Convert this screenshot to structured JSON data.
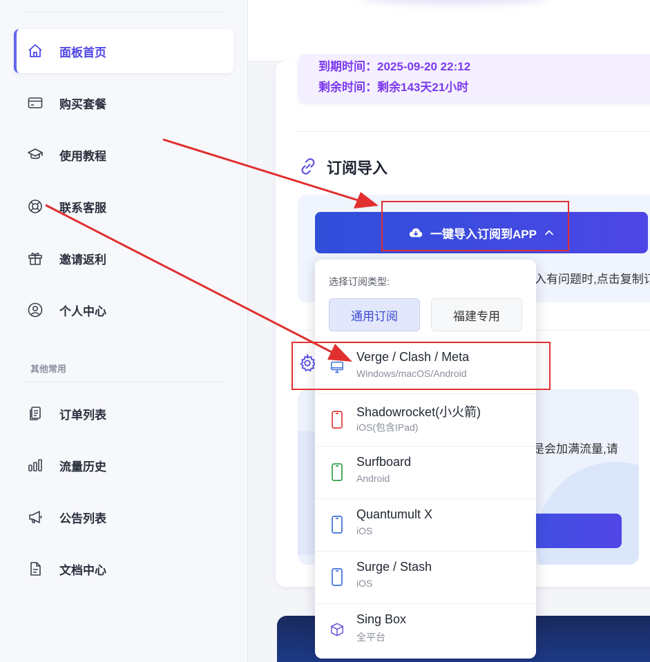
{
  "sidebar": {
    "items": [
      {
        "label": "面板首页",
        "icon": "home-icon",
        "active": true
      },
      {
        "label": "购买套餐",
        "icon": "card-icon"
      },
      {
        "label": "使用教程",
        "icon": "graduation-cap-icon"
      },
      {
        "label": "联系客服",
        "icon": "lifebuoy-icon"
      },
      {
        "label": "邀请返利",
        "icon": "gift-icon"
      },
      {
        "label": "个人中心",
        "icon": "user-circle-icon"
      }
    ],
    "section_label": "其他常用",
    "other_items": [
      {
        "label": "订单列表",
        "icon": "clipboard-icon"
      },
      {
        "label": "流量历史",
        "icon": "bar-chart-icon"
      },
      {
        "label": "公告列表",
        "icon": "megaphone-icon"
      },
      {
        "label": "文档中心",
        "icon": "document-icon"
      }
    ]
  },
  "main": {
    "expire_line": "到期时间：2025-09-20 22:12",
    "remaining_line": "剩余时间：剩余143天21小时",
    "subscription_title": "订阅导入",
    "import_button": "一键导入订阅到APP",
    "hint_text_partial": "入有问题时,点击复制订",
    "promo_text_partial": "是会加满流量,请"
  },
  "dropdown": {
    "caption": "选择订阅类型:",
    "type_general": "通用订阅",
    "type_fujian": "福建专用",
    "apps": [
      {
        "name": "Verge / Clash / Meta",
        "platform": "Windows/macOS/Android",
        "icon": "desktop-icon",
        "color": "#3b6fd8"
      },
      {
        "name": "Shadowrocket(小火箭)",
        "platform": "iOS(包含IPad)",
        "icon": "phone-icon",
        "color": "#e03a3a"
      },
      {
        "name": "Surfboard",
        "platform": "Android",
        "icon": "phone-icon",
        "color": "#2e9e48"
      },
      {
        "name": "Quantumult X",
        "platform": "iOS",
        "icon": "phone-icon",
        "color": "#3b6fd8"
      },
      {
        "name": "Surge / Stash",
        "platform": "iOS",
        "icon": "phone-icon",
        "color": "#3b6fd8"
      },
      {
        "name": "Sing Box",
        "platform": "全平台",
        "icon": "cube-icon",
        "color": "#6a4fd8"
      }
    ]
  },
  "colors": {
    "accent": "#4f46e5",
    "annotation": "#e03030",
    "expire_text": "#7c3aed"
  }
}
